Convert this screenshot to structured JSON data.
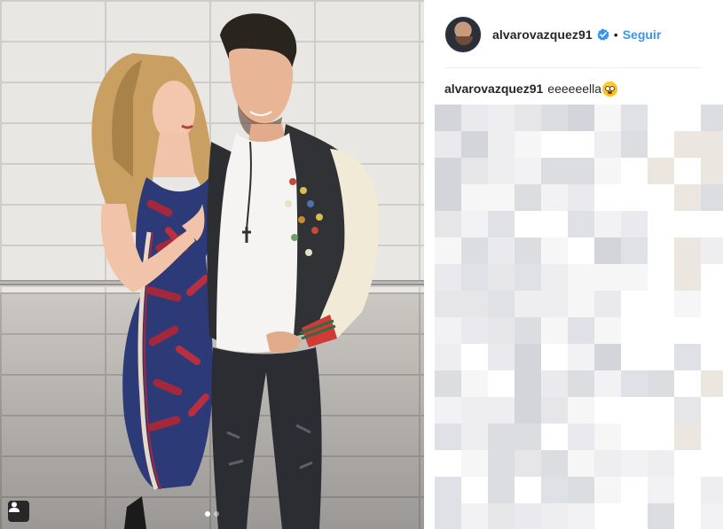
{
  "post": {
    "username": "alvarovazquez91",
    "separator": "•",
    "follow_label": "Seguir",
    "caption_user": "alvarovazquez91",
    "caption_text": "eeeeeella"
  },
  "icons": {
    "verified": "verified-badge-icon",
    "user_tag": "user-tag-icon",
    "emoji": "flushed-face-emoji"
  },
  "colors": {
    "link_blue": "#3897f0",
    "verified_blue": "#3897f0",
    "text": "#262626"
  },
  "carousel": {
    "total_slides": 2,
    "active_slide": 1
  }
}
